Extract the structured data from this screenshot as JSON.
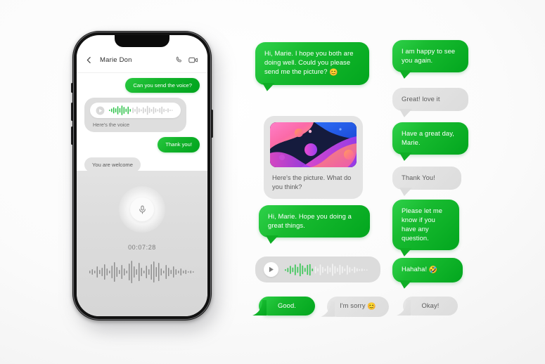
{
  "meta": {
    "scene": "messaging-app-illustration",
    "background_color": "#f5f5f5",
    "accent_green": "#15b52c",
    "bubble_gray": "#dedede"
  },
  "phone": {
    "header": {
      "back_icon": "chevron-left-icon",
      "contact_name": "Marie Don",
      "call_icon": "phone-icon",
      "video_icon": "video-camera-icon"
    },
    "messages": [
      {
        "id": "m1",
        "side": "out",
        "type": "text",
        "text": "Can you send the voice?"
      },
      {
        "id": "m2",
        "side": "in",
        "type": "voice",
        "caption": "Here's the voice",
        "play_icon": "play-icon"
      },
      {
        "id": "m3",
        "side": "out",
        "type": "text",
        "text": "Thank you!"
      },
      {
        "id": "m4",
        "side": "in",
        "type": "text",
        "text": "You are welcome"
      }
    ],
    "recorder": {
      "mic_icon": "microphone-icon",
      "timer": "00:07:28",
      "waveform_name": "audio-waveform"
    }
  },
  "bubbles": [
    {
      "id": "b1",
      "tone": "green",
      "tail": "bottom-left",
      "text": "Hi, Marie. I hope you both are doing well. Could you please send me the picture?",
      "emoji": "😊"
    },
    {
      "id": "b2",
      "tone": "green",
      "tail": "bottom-left",
      "text": "I am happy to see you again."
    },
    {
      "id": "b3",
      "tone": "gray",
      "tail": "bottom-left",
      "text": "Great! love it"
    },
    {
      "id": "b4",
      "tone": "gray",
      "tail": "none",
      "type": "picture",
      "caption": "Here's the picture. What do you think?",
      "image_name": "abstract-gradient-image"
    },
    {
      "id": "b5",
      "tone": "green",
      "tail": "bottom-left",
      "text": "Have a great day, Marie."
    },
    {
      "id": "b6",
      "tone": "gray",
      "tail": "bottom-left",
      "text": "Thank You!"
    },
    {
      "id": "b7",
      "tone": "green",
      "tail": "bottom-left",
      "text": "Hi, Marie. Hope you doing a great things."
    },
    {
      "id": "b8",
      "tone": "green",
      "tail": "bottom-left",
      "text": "Please let me know if you have any question."
    },
    {
      "id": "b9",
      "tone": "gray",
      "tail": "none",
      "type": "voice",
      "play_icon": "play-icon",
      "waveform_name": "voice-waveform"
    },
    {
      "id": "b10",
      "tone": "green",
      "tail": "bottom-left",
      "text": "Hahaha!",
      "emoji": "🤣"
    },
    {
      "id": "b11",
      "tone": "green",
      "tail": "left-swoop",
      "text": "Good."
    },
    {
      "id": "b12",
      "tone": "gray",
      "tail": "left-swoop",
      "text": "I'm sorry",
      "emoji": "😊"
    },
    {
      "id": "b13",
      "tone": "gray",
      "tail": "left-swoop",
      "text": "Okay!"
    }
  ]
}
